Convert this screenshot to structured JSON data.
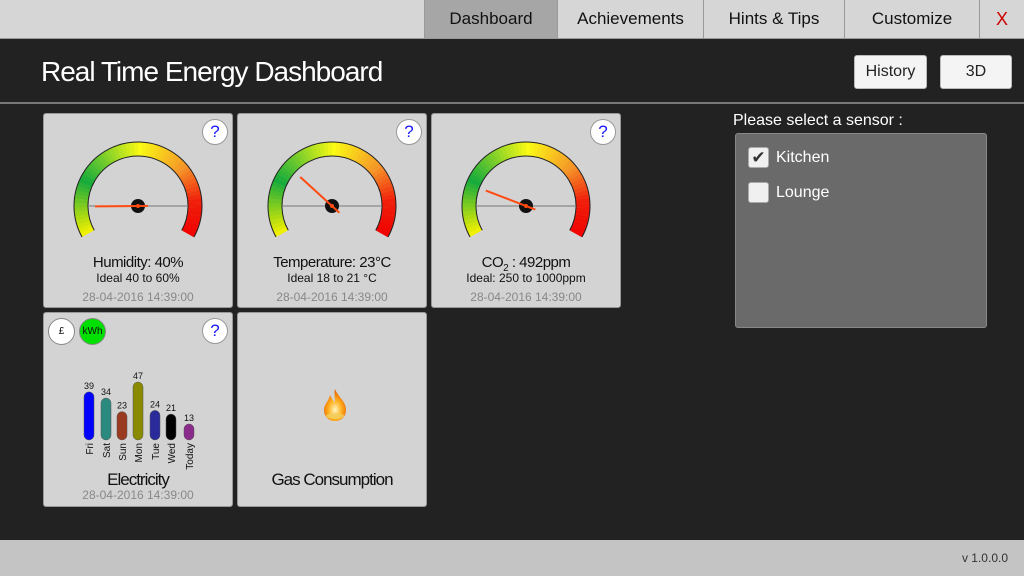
{
  "tabs": [
    {
      "label": "Dashboard",
      "active": true
    },
    {
      "label": "Achievements"
    },
    {
      "label": "Hints & Tips"
    },
    {
      "label": "Customize"
    }
  ],
  "close_label": "X",
  "header": {
    "title": "Real Time Energy Dashboard",
    "history_label": "History",
    "3d_label": "3D"
  },
  "gauges": [
    {
      "name": "humidity",
      "reading": "Humidity:  40%",
      "ideal": "Ideal 40 to 60%",
      "timestamp": "28-04-2016 14:39:00",
      "needle_level": 0.12
    },
    {
      "name": "temperature",
      "reading": "Temperature: 23°C",
      "ideal": "Ideal 18 to 21 °C",
      "timestamp": "28-04-2016 14:39:00",
      "needle_level": 0.3
    },
    {
      "name": "co2",
      "reading_prefix": "CO",
      "reading_sub": "2",
      "reading_suffix": " : 492ppm",
      "ideal": "Ideal: 250 to 1000ppm",
      "timestamp": "28-04-2016 14:39:00",
      "needle_level": 0.21
    }
  ],
  "help_label": "?",
  "electricity": {
    "pound_label": "£",
    "kwh_label": "kWh",
    "kwh_active_color": "#00e000",
    "title": "Electricity",
    "timestamp": "28-04-2016 14:39:00",
    "chart_data": {
      "type": "bar",
      "categories": [
        "Fri",
        "Sat",
        "Sun",
        "Mon",
        "Tue",
        "Wed",
        "Today"
      ],
      "values": [
        39,
        34,
        23,
        47,
        24,
        21,
        13
      ],
      "colors": [
        "#0000ff",
        "#2a8a80",
        "#9a3a20",
        "#8a8a00",
        "#2a2a9a",
        "#000000",
        "#8a2a8a"
      ]
    }
  },
  "gas": {
    "title": "Gas Consumption",
    "icon": "flame-icon"
  },
  "sensor": {
    "label": "Please select a sensor :",
    "items": [
      {
        "label": "Kitchen",
        "checked": true
      },
      {
        "label": "Lounge",
        "checked": false
      }
    ]
  },
  "footer": {
    "version": "v 1.0.0.0"
  }
}
